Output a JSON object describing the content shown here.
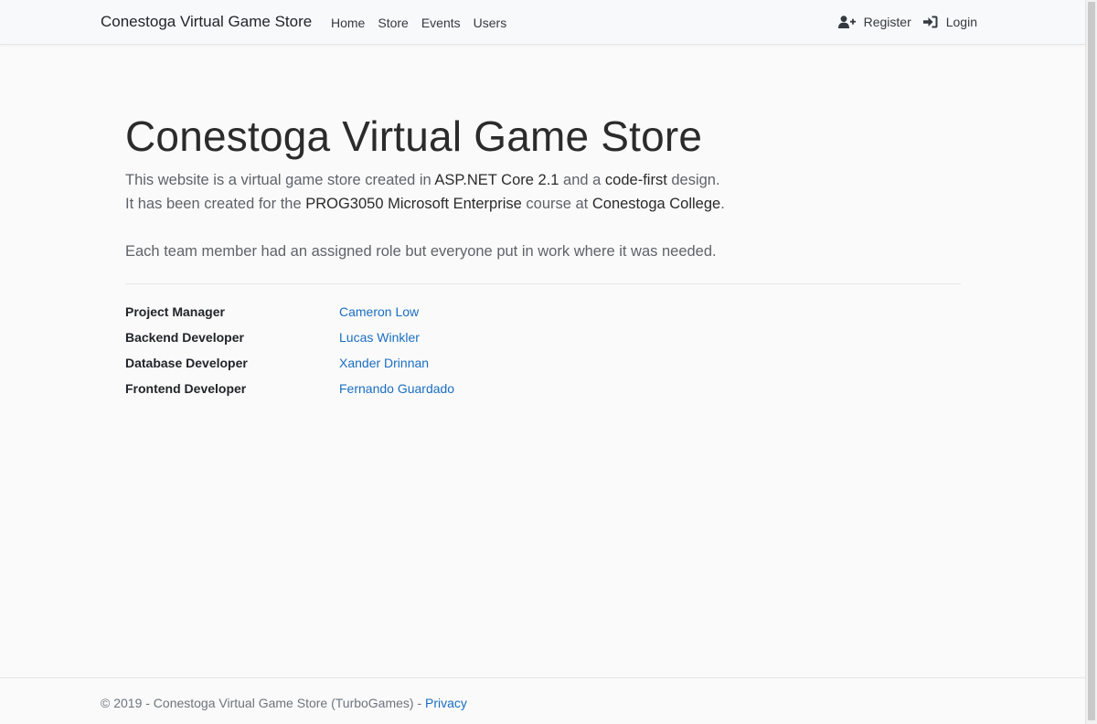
{
  "navbar": {
    "brand": "Conestoga Virtual Game Store",
    "links": [
      "Home",
      "Store",
      "Events",
      "Users"
    ],
    "register_label": "Register",
    "login_label": "Login",
    "register_icon": "user-plus-icon",
    "login_icon": "sign-in-icon"
  },
  "main": {
    "title": "Conestoga Virtual Game Store",
    "line1": {
      "t1": "This website is a virtual game store created in ",
      "b1": "ASP.NET Core 2.1",
      "t2": " and a ",
      "b2": "code-first",
      "t3": " design."
    },
    "line2": {
      "t1": "It has been created for the ",
      "b1": "PROG3050 Microsoft Enterprise",
      "t2": " course at ",
      "b2": "Conestoga College",
      "t3": "."
    },
    "line3": "Each team member had an assigned role but everyone put in work where it was needed.",
    "team": [
      {
        "role": "Project Manager",
        "name": "Cameron Low"
      },
      {
        "role": "Backend Developer",
        "name": "Lucas Winkler"
      },
      {
        "role": "Database Developer",
        "name": "Xander Drinnan"
      },
      {
        "role": "Frontend Developer",
        "name": "Fernando Guardado"
      }
    ]
  },
  "footer": {
    "text": "© 2019 - Conestoga Virtual Game Store (TurboGames) - ",
    "privacy_label": "Privacy"
  },
  "colors": {
    "link": "#1b6ec2",
    "background": "#fafafa",
    "navbar": "#f8f9fa"
  }
}
